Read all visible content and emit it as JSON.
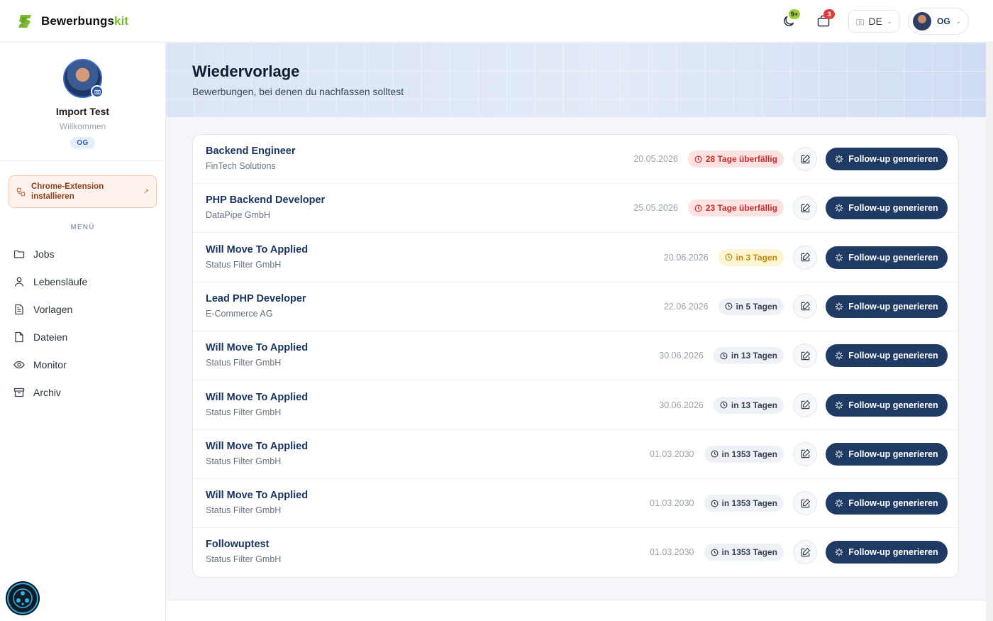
{
  "brand": {
    "name_main": "Bewerbungs",
    "name_accent": "kit",
    "accent_color": "#7dbb2f"
  },
  "header": {
    "notifications_badge": "9+",
    "inbox_badge": "3",
    "language": "DE",
    "language_flag": "▯▯",
    "user_initials": "OG"
  },
  "sidebar": {
    "profile_name": "Import Test",
    "profile_sub": "Willkommen",
    "profile_tag": "OG",
    "extension_label_1": "Chrome-Extension",
    "extension_label_2": "installieren",
    "menu_title": "MENÜ",
    "items": [
      {
        "label": "Jobs",
        "icon": "folder-icon"
      },
      {
        "label": "Lebensläufe",
        "icon": "user-icon"
      },
      {
        "label": "Vorlagen",
        "icon": "document-icon"
      },
      {
        "label": "Dateien",
        "icon": "file-icon"
      },
      {
        "label": "Monitor",
        "icon": "eye-icon"
      },
      {
        "label": "Archiv",
        "icon": "archive-icon"
      }
    ]
  },
  "page": {
    "title": "Wiedervorlage",
    "subtitle": "Bewerbungen, bei denen du nachfassen solltest"
  },
  "followup_label": "Follow-up generieren",
  "rows": [
    {
      "title": "Backend Engineer",
      "company": "FinTech Solutions",
      "date": "20.05.2026",
      "status": "28 Tage überfällig",
      "kind": "overdue"
    },
    {
      "title": "PHP Backend Developer",
      "company": "DataPipe GmbH",
      "date": "25.05.2026",
      "status": "23 Tage überfällig",
      "kind": "overdue"
    },
    {
      "title": "Will Move To Applied",
      "company": "Status Filter GmbH",
      "date": "20.06.2026",
      "status": "in 3 Tagen",
      "kind": "soon"
    },
    {
      "title": "Lead PHP Developer",
      "company": "E-Commerce AG",
      "date": "22.06.2026",
      "status": "in 5 Tagen",
      "kind": "future"
    },
    {
      "title": "Will Move To Applied",
      "company": "Status Filter GmbH",
      "date": "30.06.2026",
      "status": "in 13 Tagen",
      "kind": "future"
    },
    {
      "title": "Will Move To Applied",
      "company": "Status Filter GmbH",
      "date": "30.06.2026",
      "status": "in 13 Tagen",
      "kind": "future"
    },
    {
      "title": "Will Move To Applied",
      "company": "Status Filter GmbH",
      "date": "01.03.2030",
      "status": "in 1353 Tagen",
      "kind": "future"
    },
    {
      "title": "Will Move To Applied",
      "company": "Status Filter GmbH",
      "date": "01.03.2030",
      "status": "in 1353 Tagen",
      "kind": "future"
    },
    {
      "title": "Followuptest",
      "company": "Status Filter GmbH",
      "date": "01.03.2030",
      "status": "in 1353 Tagen",
      "kind": "future"
    }
  ],
  "colors": {
    "primary_button": "#1f3a63",
    "overdue": "#d12b2b",
    "soon": "#c28a08"
  }
}
